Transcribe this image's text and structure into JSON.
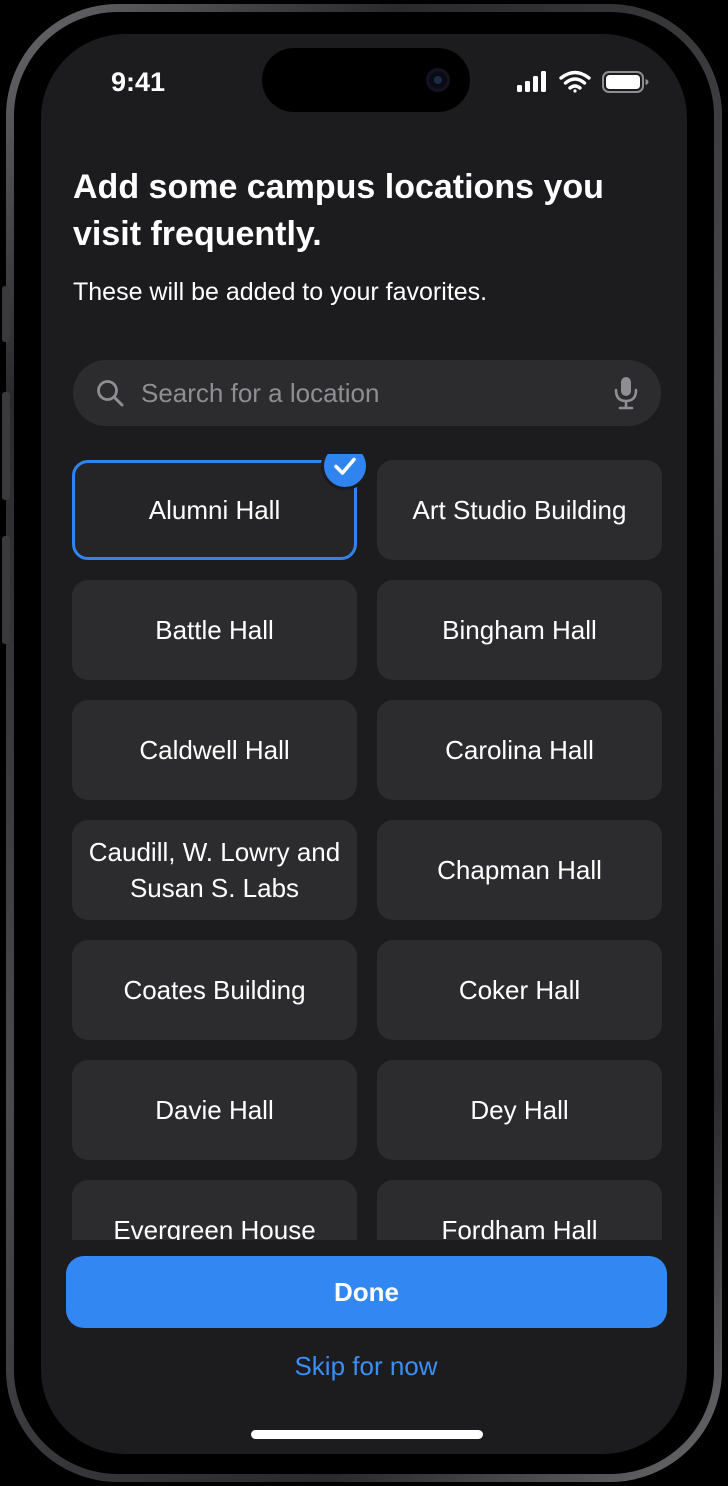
{
  "status_bar": {
    "time": "9:41",
    "icons": [
      "cellular-signal-icon",
      "wifi-icon",
      "battery-icon"
    ]
  },
  "header": {
    "title": "Add some campus locations you visit frequently.",
    "subtitle": "These will be added to your favorites."
  },
  "search": {
    "placeholder": "Search for a location",
    "value": "",
    "icons": [
      "search-icon",
      "microphone-icon"
    ]
  },
  "locations": [
    {
      "label": "Alumni Hall",
      "selected": true
    },
    {
      "label": "Art Studio Building",
      "selected": false
    },
    {
      "label": "Battle Hall",
      "selected": false
    },
    {
      "label": "Bingham Hall",
      "selected": false
    },
    {
      "label": "Caldwell Hall",
      "selected": false
    },
    {
      "label": "Carolina Hall",
      "selected": false
    },
    {
      "label": "Caudill, W. Lowry and Susan S. Labs",
      "selected": false
    },
    {
      "label": "Chapman Hall",
      "selected": false
    },
    {
      "label": "Coates Building",
      "selected": false
    },
    {
      "label": "Coker Hall",
      "selected": false
    },
    {
      "label": "Davie Hall",
      "selected": false
    },
    {
      "label": "Dey Hall",
      "selected": false
    },
    {
      "label": "Evergreen House",
      "selected": false
    },
    {
      "label": "Fordham Hall",
      "selected": false
    }
  ],
  "actions": {
    "done_label": "Done",
    "skip_label": "Skip for now"
  },
  "colors": {
    "accent": "#3287f2",
    "background": "#1c1c1e",
    "tile": "#2c2c2e",
    "placeholder": "#8e8e93"
  }
}
